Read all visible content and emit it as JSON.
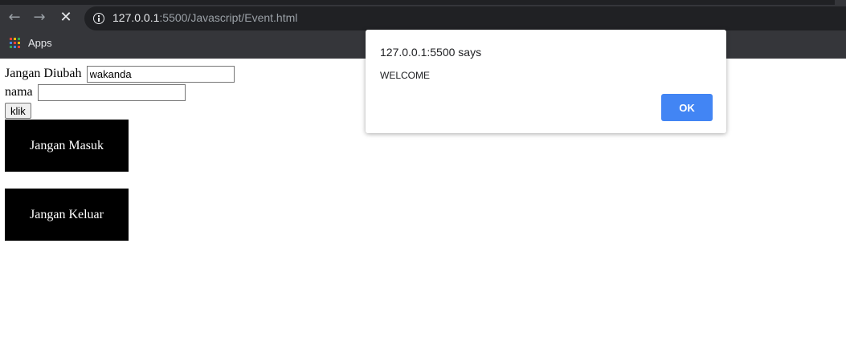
{
  "browser": {
    "url_host": "127.0.0.1",
    "url_rest": ":5500/Javascript/Event.html",
    "bookmarks": {
      "apps_label": "Apps"
    },
    "icons": {
      "back": "back-arrow-icon",
      "forward": "forward-arrow-icon",
      "stop": "stop-loading-icon",
      "info": "info-icon",
      "apps": "apps-grid-icon"
    }
  },
  "form": {
    "field1_label": "Jangan Diubah",
    "field1_value": "wakanda",
    "field2_label": "nama",
    "field2_value": "",
    "button_label": "klik"
  },
  "boxes": {
    "box1_label": "Jangan Masuk",
    "box2_label": "Jangan Keluar"
  },
  "alert": {
    "title": "127.0.0.1:5500 says",
    "message": "WELCOME",
    "ok_label": "OK"
  },
  "colors": {
    "chrome_bg": "#35363a",
    "omnibox_bg": "#202124",
    "box_bg": "#000000",
    "ok_button": "#4285f4"
  }
}
